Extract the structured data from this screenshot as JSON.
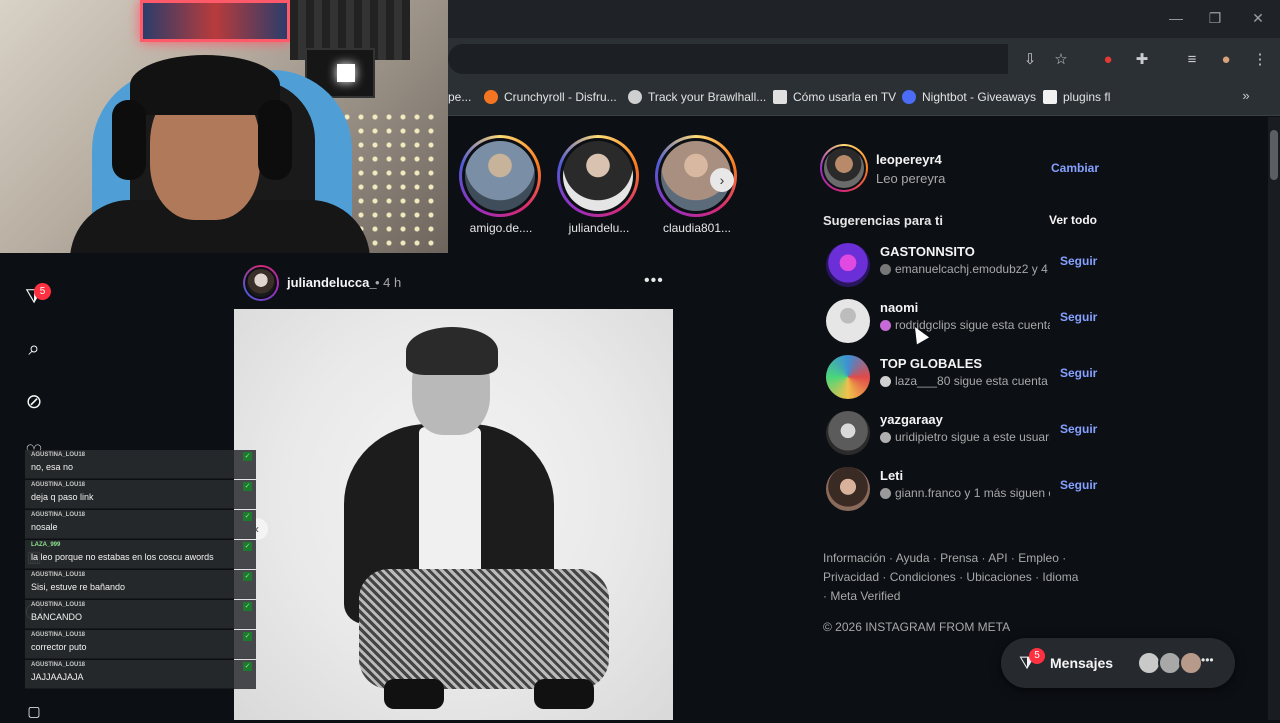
{
  "browser": {
    "bookmarks": [
      {
        "label": "pe...",
        "color": "#8a8a8a"
      },
      {
        "label": "Crunchyroll - Disfru...",
        "color": "#f47521"
      },
      {
        "label": "Track your Brawlhall...",
        "color": "#cfcfcf"
      },
      {
        "label": "Cómo usarla en TV",
        "color": "#e0e0e0"
      },
      {
        "label": "Nightbot - Giveaways",
        "color": "#4a6cf7"
      },
      {
        "label": "plugins fl",
        "color": "#f2f2f2"
      }
    ],
    "overflow_icon": "double-chevron-icon"
  },
  "stories": [
    {
      "username": "amigo.de....",
      "color": "#7a8fa6"
    },
    {
      "username": "juliandelu...",
      "color": "#5a5a5a"
    },
    {
      "username": "claudia801...",
      "color": "#a88f80"
    }
  ],
  "post": {
    "username": "juliandelucca_",
    "time": " • 4 h",
    "more": "•••"
  },
  "nav": {
    "notifications_badge": "5"
  },
  "chat": [
    {
      "user": "AGUSTINA_LOU18",
      "message": "no, esa no",
      "user_color": "#c7a6ff"
    },
    {
      "user": "AGUSTINA_LOU18",
      "message": "deja q paso link",
      "user_color": "#c7a6ff"
    },
    {
      "user": "AGUSTINA_LOU18",
      "message": "nosale",
      "user_color": "#c7a6ff"
    },
    {
      "user": "LAZA_999",
      "message": "la leo porque no estabas en los coscu awords",
      "user_color": "#8fe38f"
    },
    {
      "user": "AGUSTINA_LOU18",
      "message": "Sisi, estuve re bañando",
      "user_color": "#c7a6ff"
    },
    {
      "user": "AGUSTINA_LOU18",
      "message": "BANCANDO",
      "user_color": "#c7a6ff"
    },
    {
      "user": "AGUSTINA_LOU18",
      "message": "corrector puto",
      "user_color": "#c7a6ff"
    },
    {
      "user": "AGUSTINA_LOU18",
      "message": "JAJJAAJAJA",
      "user_color": "#c7a6ff"
    }
  ],
  "profile": {
    "username": "leopereyr4",
    "name": "Leo pereyra",
    "switch_label": "Cambiar"
  },
  "suggestions": {
    "title": "Sugerencias para ti",
    "see_all": "Ver todo",
    "items": [
      {
        "name": "GASTONNSITO",
        "sub": "emanuelcachj.emodubz2 y 4",
        "follow": "Seguir",
        "color": "#6a2fd6"
      },
      {
        "name": "naomi",
        "sub": "rodridgclips sigue esta cuenta",
        "follow": "Seguir",
        "color": "#d9d9d9"
      },
      {
        "name": "TOP GLOBALES",
        "sub": "laza___80 sigue esta cuenta",
        "follow": "Seguir",
        "color": "#3d8fd6"
      },
      {
        "name": "yazgaraay",
        "sub": "uridipietro sigue a este usuario",
        "follow": "Seguir",
        "color": "#5b5b5b"
      },
      {
        "name": "Leti",
        "sub": "giann.franco y 1 más siguen e",
        "follow": "Seguir",
        "color": "#8a6a5a"
      }
    ]
  },
  "footer": {
    "links": "Información · Ayuda · Prensa · API · Empleo · Privacidad · Condiciones · Ubicaciones · Idioma · Meta Verified",
    "copyright": "© 2026 INSTAGRAM FROM META"
  },
  "messages": {
    "label": "Mensajes",
    "badge": "5",
    "more": "•••"
  }
}
